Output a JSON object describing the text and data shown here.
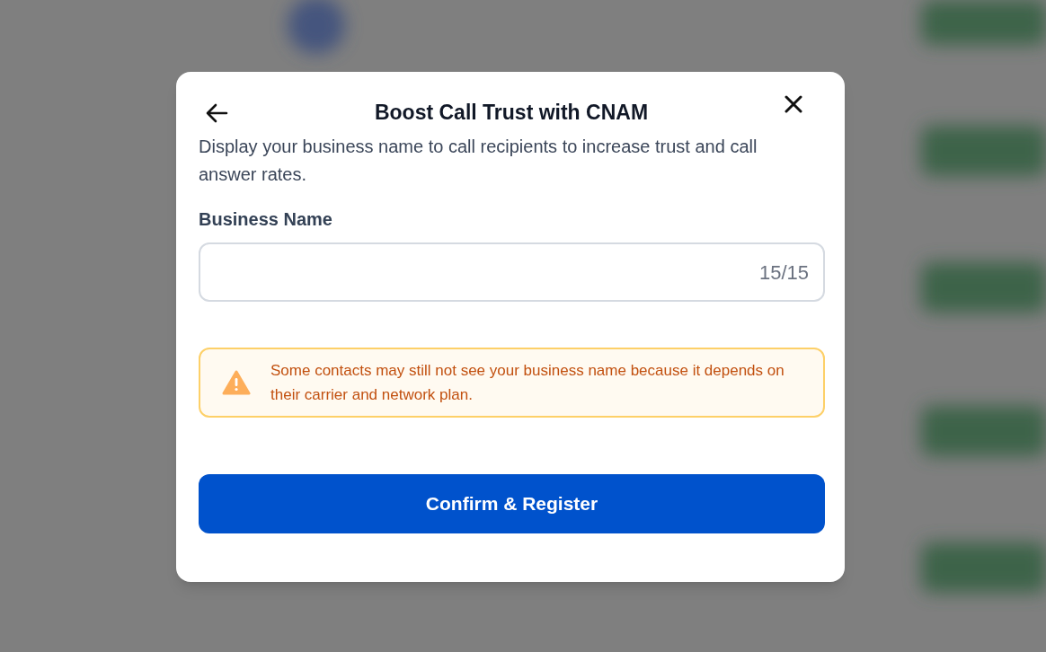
{
  "dialog": {
    "title": "Boost Call Trust with CNAM",
    "description": "Display your business name to call recipients to increase trust and call answer rates.",
    "field": {
      "label": "Business Name",
      "counter": "15/15"
    },
    "notice": {
      "text": "Some contacts may still not see your business name because it depends on their carrier and network plan."
    },
    "primary_button": "Confirm & Register"
  }
}
